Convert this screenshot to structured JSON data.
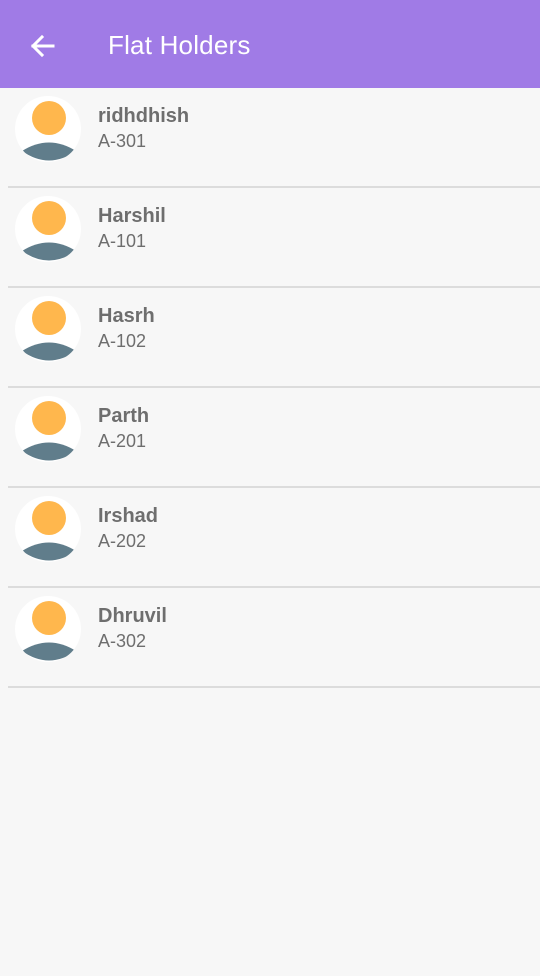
{
  "appbar": {
    "title": "Flat Holders",
    "back_icon": "arrow-left-icon",
    "background_color": "#a07be6"
  },
  "holders": [
    {
      "name": "ridhdhish",
      "flat": "A-301"
    },
    {
      "name": "Harshil",
      "flat": "A-101"
    },
    {
      "name": "Hasrh",
      "flat": "A-102"
    },
    {
      "name": "Parth",
      "flat": "A-201"
    },
    {
      "name": "Irshad",
      "flat": "A-202"
    },
    {
      "name": "Dhruvil",
      "flat": "A-302"
    }
  ],
  "avatar": {
    "icon": "user-avatar-icon",
    "head_color": "#ffb74d",
    "body_color": "#607d8b"
  }
}
